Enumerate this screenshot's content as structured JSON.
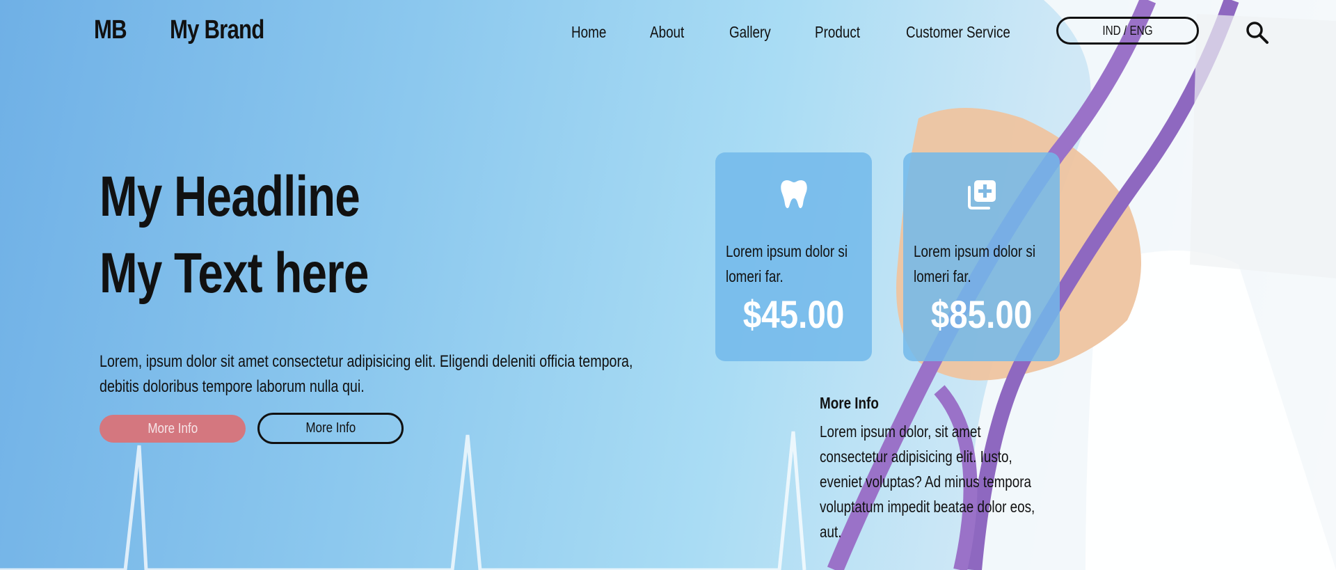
{
  "header": {
    "logo": "MB",
    "brand": "My Brand",
    "nav": [
      "Home",
      "About",
      "Gallery",
      "Product",
      "Customer Service"
    ],
    "language_button": "IND / ENG",
    "search_icon": "search-icon"
  },
  "hero": {
    "headline_line1": "My Headline",
    "headline_line2": "My Text here",
    "lead": "Lorem, ipsum dolor sit amet consectetur adipisicing elit. Eligendi deleniti officia tempora, debitis doloribus tempore laborum nulla qui.",
    "primary_button": "More Info",
    "secondary_button": "More Info"
  },
  "cards": [
    {
      "icon": "tooth-icon",
      "text": "Lorem ipsum dolor si lomeri far.",
      "price": "$45.00"
    },
    {
      "icon": "medical-copy-plus-icon",
      "text": "Lorem ipsum dolor si lomeri far.",
      "price": "$85.00"
    }
  ],
  "more_info": {
    "title": "More Info",
    "text": "Lorem ipsum dolor, sit amet consectetur adipisicing elit. Iusto, eveniet voluptas? Ad minus tempora voluptatum impedit beatae dolor eos, aut."
  },
  "colors": {
    "card_bg": "#72b8ea",
    "primary_button_bg": "#d4777f",
    "text": "#111111"
  }
}
